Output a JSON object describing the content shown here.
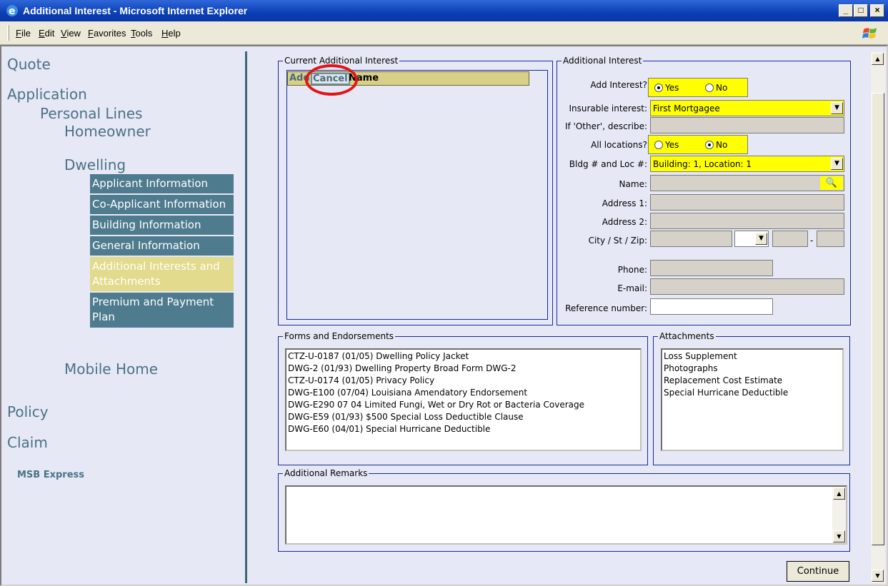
{
  "window": {
    "title": "Additional Interest - Microsoft Internet Explorer",
    "min_label": "_",
    "max_label": "□",
    "close_label": "×"
  },
  "menu": [
    "File",
    "Edit",
    "View",
    "Favorites",
    "Tools",
    "Help"
  ],
  "nav": {
    "quote": "Quote",
    "application": "Application",
    "personal_lines": "Personal Lines",
    "homeowner": "Homeowner",
    "dwelling": "Dwelling",
    "items": [
      {
        "label": "Applicant Information"
      },
      {
        "label": "Co-Applicant Information"
      },
      {
        "label": "Building Information"
      },
      {
        "label": "General Information"
      },
      {
        "label": "Additional Interests and Attachments"
      },
      {
        "label": "Premium and Payment Plan"
      }
    ],
    "mobile_home": "Mobile Home",
    "policy": "Policy",
    "claim": "Claim",
    "msb_express": "MSB Express"
  },
  "current_interest": {
    "legend": "Current Additional Interest",
    "add": "Add",
    "cancel": "Cancel",
    "name_header": "Name"
  },
  "additional_interest": {
    "legend": "Additional Interest",
    "add_interest_label": "Add Interest?",
    "yes": "Yes",
    "no": "No",
    "add_interest_value": "Yes",
    "insurable_label": "Insurable interest:",
    "insurable_value": "First Mortgagee",
    "other_label": "If 'Other', describe:",
    "all_locations_label": "All locations?",
    "all_locations_value": "No",
    "bldg_label": "Bldg # and Loc #:",
    "bldg_value": "Building: 1, Location: 1",
    "name_label": "Name:",
    "address1_label": "Address 1:",
    "address2_label": "Address 2:",
    "city_label": "City / St / Zip:",
    "zip_dash": "-",
    "phone_label": "Phone:",
    "email_label": "E-mail:",
    "reference_label": "Reference number:"
  },
  "forms": {
    "legend": "Forms and Endorsements",
    "items": [
      "CTZ-U-0187 (01/05) Dwelling Policy Jacket",
      "DWG-2 (01/93) Dwelling Property Broad Form DWG-2",
      "CTZ-U-0174 (01/05) Privacy Policy",
      "DWG-E100 (07/04) Louisiana Amendatory Endorsement",
      "DWG-E290 07 04 Limited Fungi, Wet or Dry Rot or Bacteria Coverage",
      "DWG-E59 (01/93) $500 Special Loss Deductible Clause",
      "DWG-E60 (04/01) Special Hurricane Deductible"
    ]
  },
  "attachments": {
    "legend": "Attachments",
    "items": [
      "Loss Supplement",
      "Photographs",
      "Replacement Cost Estimate",
      "Special Hurricane Deductible"
    ]
  },
  "remarks": {
    "legend": "Additional Remarks"
  },
  "continue_label": "Continue",
  "colors": {
    "nav_box": "#4f7b8e",
    "nav_active": "#e2da8c",
    "highlight_yellow": "#ffff00",
    "frame_blue": "#1a2a9c",
    "annotation_red": "#e01616"
  }
}
